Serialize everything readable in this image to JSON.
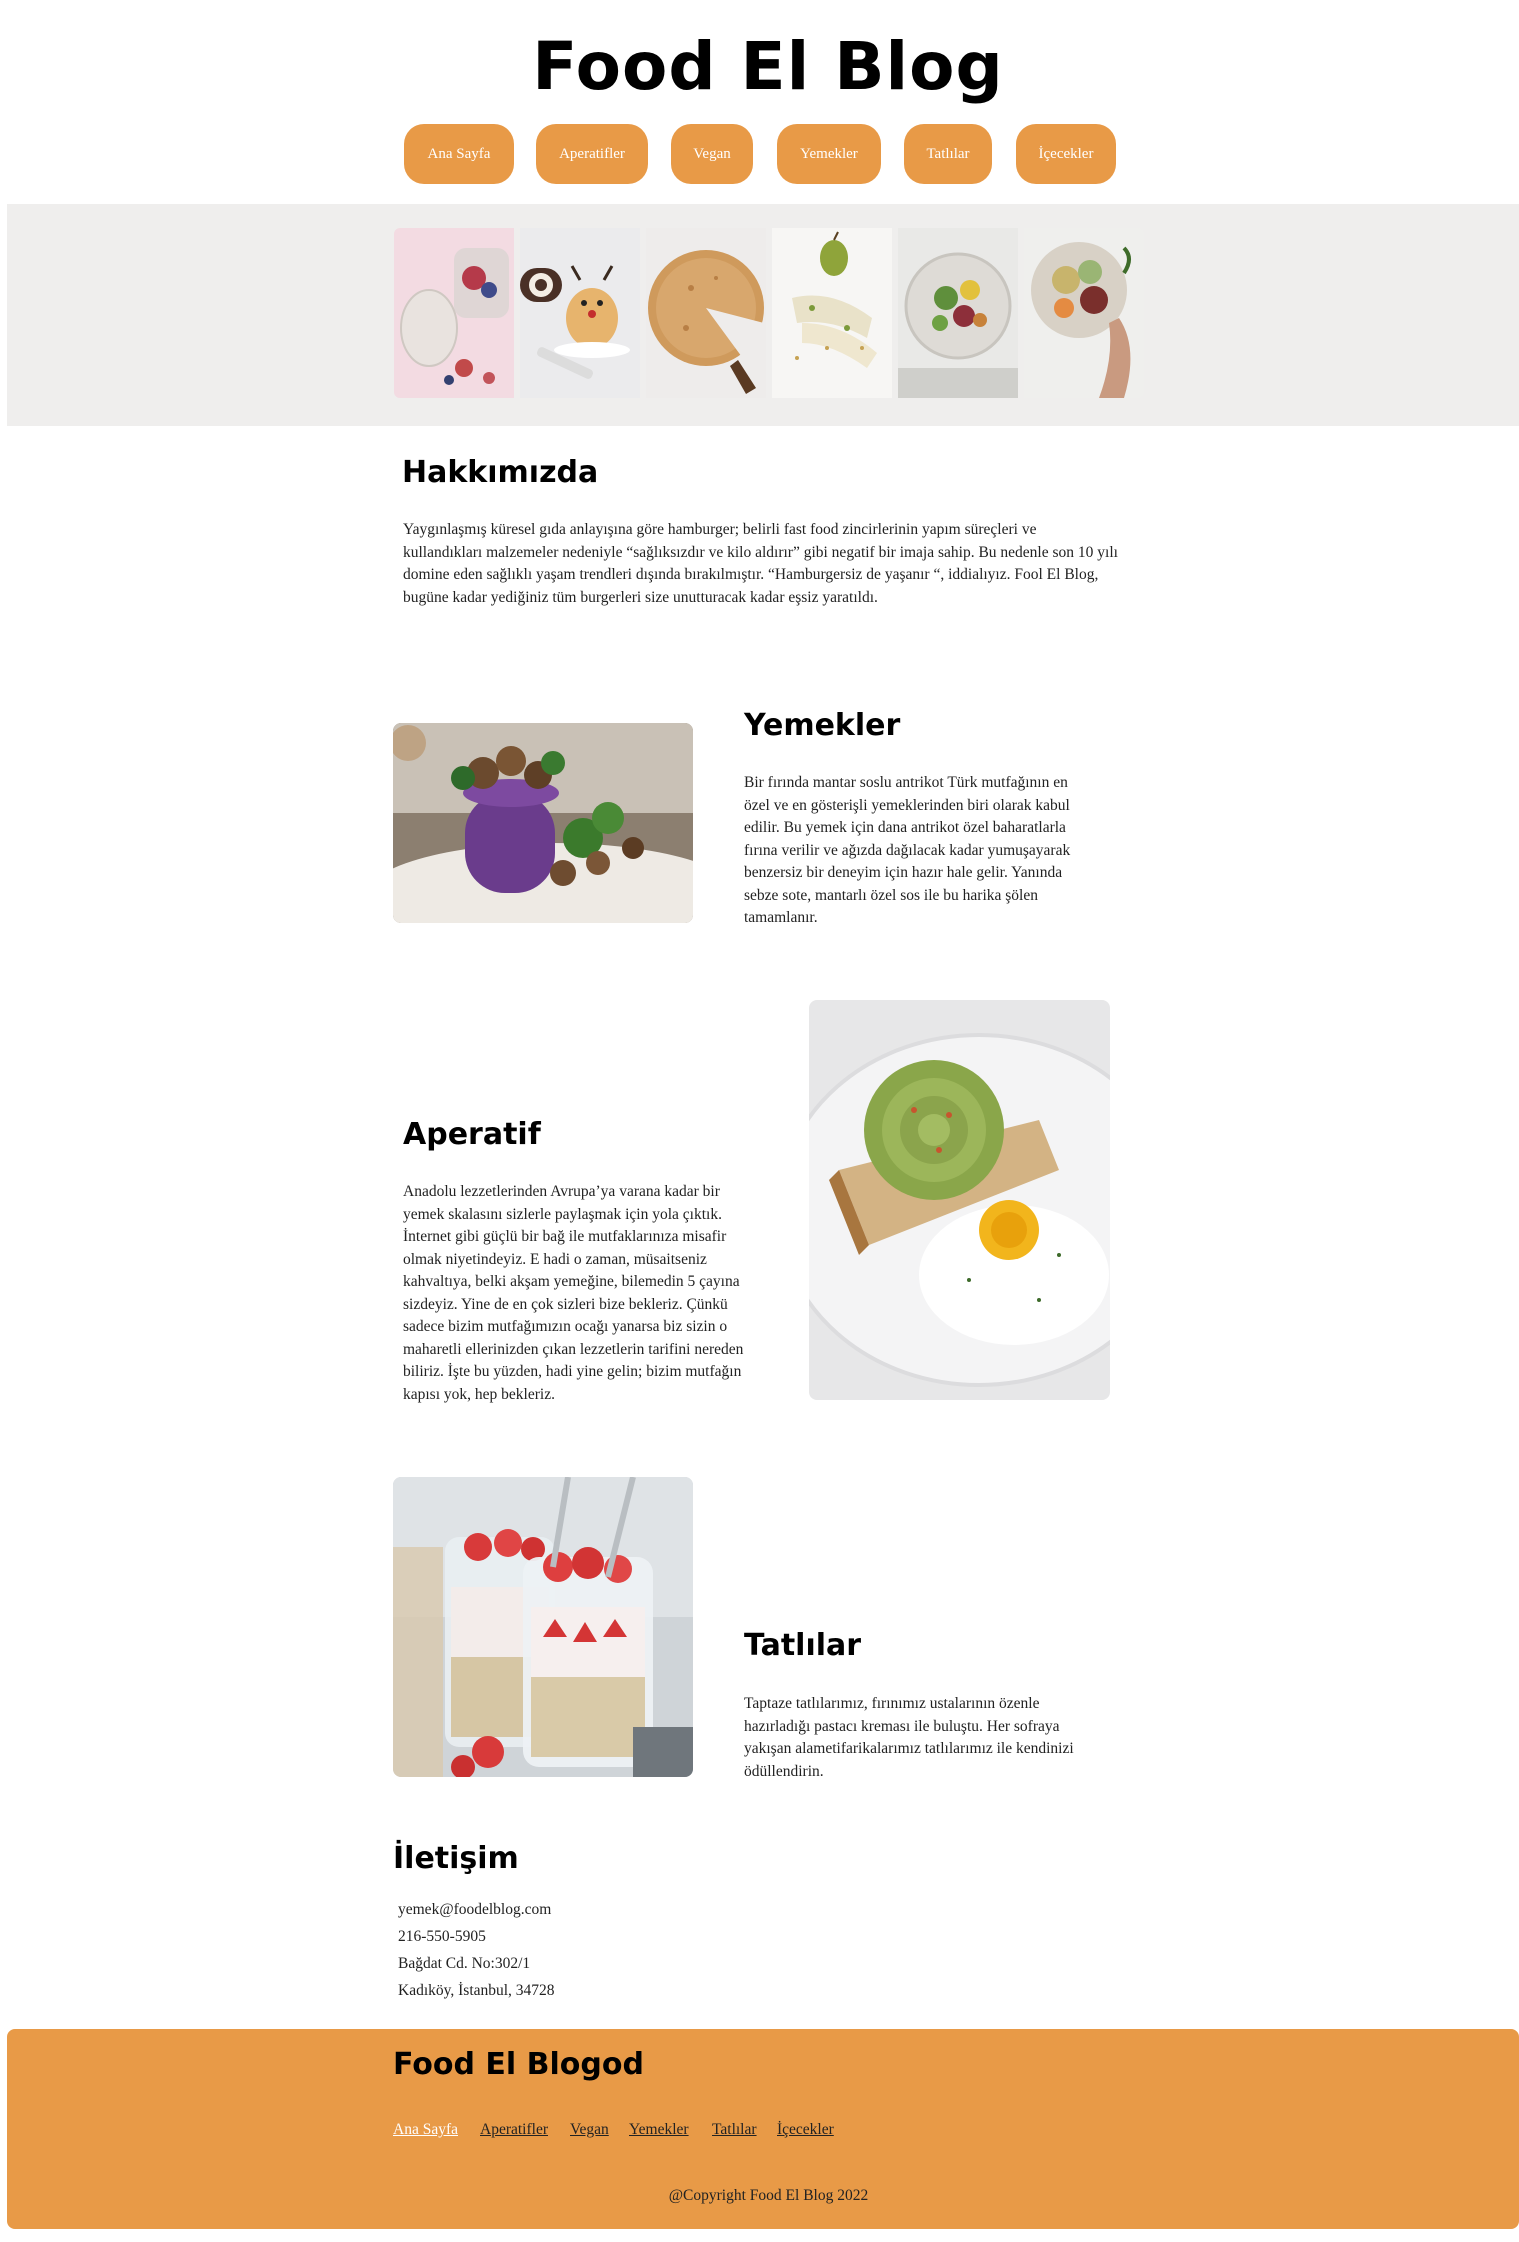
{
  "site": {
    "title": "Food El Blog"
  },
  "nav": {
    "items": [
      {
        "label": "Ana Sayfa"
      },
      {
        "label": "Aperatifler"
      },
      {
        "label": "Vegan"
      },
      {
        "label": "Yemekler"
      },
      {
        "label": "Tatlılar"
      },
      {
        "label": "İçecekler"
      }
    ]
  },
  "about": {
    "title": "Hakkımızda",
    "text": "Yaygınlaşmış küresel gıda anlayışına göre hamburger; belirli fast food zincirlerinin yapım süreçleri ve kullandıkları malzemeler nedeniyle “sağlıksızdır ve kilo aldırır” gibi negatif bir imaja sahip. Bu nedenle son 10 yılı domine eden sağlıklı yaşam trendleri dışında bırakılmıştır. “Hamburgersiz de yaşanır “, iddialıyız. Fool El Blog, bugüne kadar yediğiniz tüm burgerleri size unutturacak kadar eşsiz yaratıldı."
  },
  "sections": {
    "yemekler": {
      "title": "Yemekler",
      "text": "Bir fırında mantar soslu antrikot Türk mutfağının en özel ve en gösterişli yemeklerinden biri olarak kabul edilir. Bu yemek için dana antrikot özel baharatlarla fırına verilir ve ağızda dağılacak kadar yumuşayarak benzersiz bir deneyim için hazır hale gelir. Yanında sebze sote, mantarlı özel sos ile bu harika şölen tamamlanır."
    },
    "aperatif": {
      "title": "Aperatif",
      "text": "Anadolu lezzetlerinden Avrupa’ya varana kadar bir yemek skalasını sizlerle paylaşmak için yola çıktık. İnternet gibi güçlü bir bağ ile mutfaklarınıza misafir olmak niyetindeyiz. E hadi o zaman, müsaitseniz kahvaltıya, belki akşam yemeğine, bilemedin 5 çayına sizdeyiz. Yine de en çok sizleri bize bekleriz. Çünkü sadece bizim mutfağımızın ocağı yanarsa biz sizin o maharetli ellerinizden çıkan lezzetlerin tarifini nereden biliriz. İşte bu yüzden, hadi yine gelin; bizim mutfağın kapısı yok, hep bekleriz."
    },
    "tatlilar": {
      "title": "Tatlılar",
      "text": "Taptaze tatlılarımız, fırınımız ustalarının özenle hazırladığı pastacı kreması ile buluştu. Her sofraya yakışan alametifarikalarımız tatlılarımız ile kendinizi ödüllendirin."
    }
  },
  "contact": {
    "title": "İletişim",
    "email": "yemek@foodelblog.com",
    "phone": "216-550-5905",
    "address_line1": "Bağdat Cd. No:302/1",
    "address_line2": "Kadıköy, İstanbul, 34728"
  },
  "footer": {
    "title": "Food El Blogod",
    "links": [
      {
        "label": "Ana Sayfa"
      },
      {
        "label": "Aperatifler"
      },
      {
        "label": "Vegan"
      },
      {
        "label": "Yemekler"
      },
      {
        "label": "Tatlılar"
      },
      {
        "label": "İçecekler"
      }
    ],
    "copyright": "@Copyright Food El Blog 2022"
  },
  "colors": {
    "accent": "#e89a47",
    "gallery_band": "#efeeed",
    "text": "#222222"
  },
  "images": [
    "berry-jar-photo",
    "reindeer-dessert-photo",
    "pie-slice-photo",
    "pear-appetizer-photo",
    "salad-bowl-photo",
    "grain-bowl-photo",
    "purple-puree-mushroom-photo",
    "avocado-rose-toast-photo",
    "strawberry-oats-jar-photo"
  ]
}
